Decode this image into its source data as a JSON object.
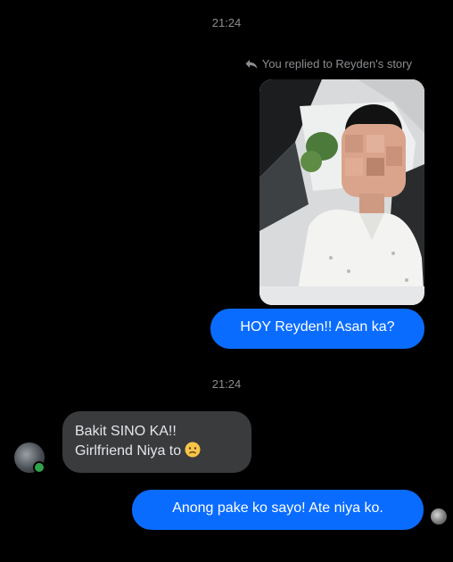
{
  "chat": {
    "timestamp_top": "21:24",
    "reply_note": "You replied to Reyden's story",
    "reply_icon": "reply-arrow-icon",
    "messages": {
      "hoy": "HOY Reyden!! Asan ka?",
      "timestamp_mid": "21:24",
      "bakit_line1": "Bakit SINO KA!!",
      "bakit_line2": "Girlfriend Niya to",
      "bakit_emoji": "worried-face-emoji",
      "anong": "Anong pake ko sayo! Ate niya ko."
    },
    "colors": {
      "background": "#000000",
      "outgoing_bubble": "#0a6cff",
      "incoming_bubble": "#3a3b3c",
      "meta_text": "#8a8d91",
      "online_status": "#31a24c"
    }
  }
}
